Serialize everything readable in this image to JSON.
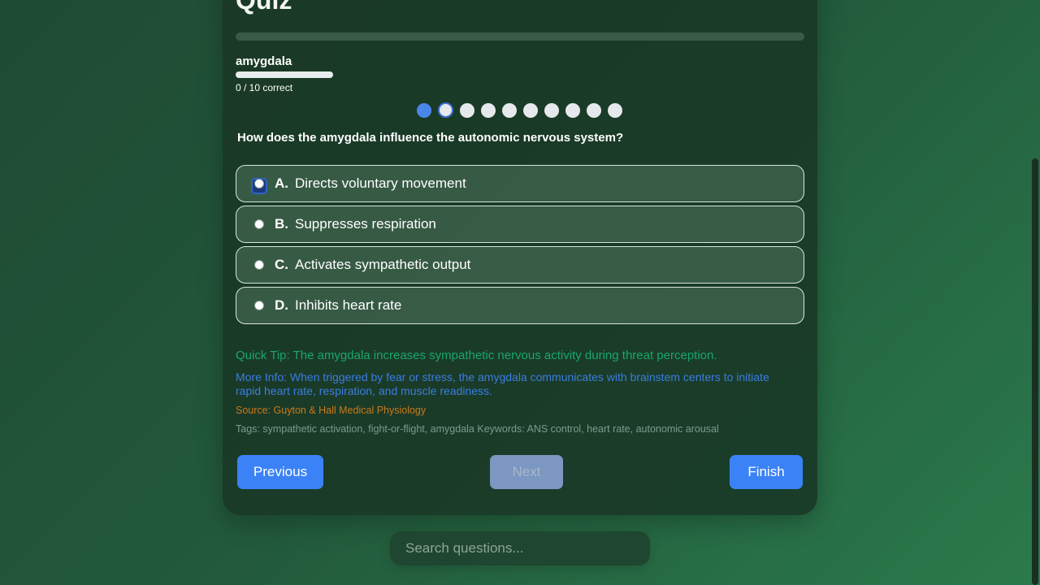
{
  "quiz": {
    "title": "Quiz",
    "overall_progress": 0.0,
    "topic": "amygdala",
    "topic_progress": 0.0,
    "score_text": "0 / 10 correct",
    "question_count": 10,
    "current_question_index": 1
  },
  "question": {
    "text": "How does the amygdala influence the autonomic nervous system?",
    "options": [
      {
        "letter": "A.",
        "text": "Directs voluntary movement"
      },
      {
        "letter": "B.",
        "text": "Suppresses respiration"
      },
      {
        "letter": "C.",
        "text": "Activates sympathetic output"
      },
      {
        "letter": "D.",
        "text": "Inhibits heart rate"
      }
    ]
  },
  "info": {
    "tip": "Quick Tip: The amygdala increases sympathetic nervous activity during threat perception.",
    "more_info": "More Info: When triggered by fear or stress, the amygdala communicates with brainstem centers to initiate rapid heart rate, respiration, and muscle readiness.",
    "source": "Source: Guyton & Hall Medical Physiology",
    "tags": "Tags: sympathetic activation, fight-or-flight, amygdala Keywords: ANS control, heart rate, autonomic arousal"
  },
  "nav": {
    "previous_label": "Previous",
    "next_label": "Next",
    "finish_label": "Finish"
  },
  "search": {
    "placeholder": "Search questions..."
  },
  "colors": {
    "accent": "#3b82f6",
    "tip": "#1aa66a",
    "info": "#3b7de0",
    "source": "#c87a1a"
  }
}
